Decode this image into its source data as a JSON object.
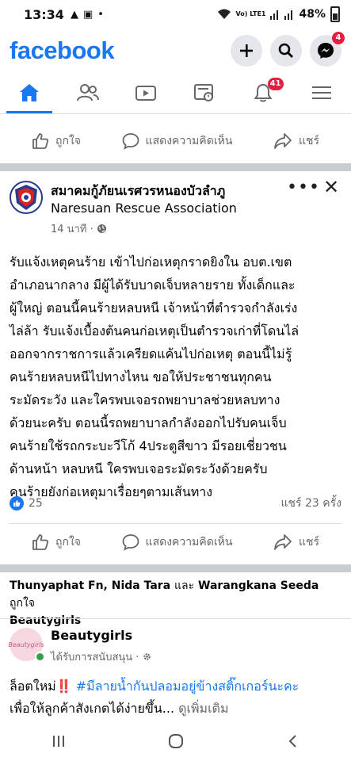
{
  "status_bar": {
    "time": "13:34",
    "network": "Vo) LTE1",
    "battery": "48%"
  },
  "header": {
    "logo": "facebook",
    "messenger_badge": "4"
  },
  "nav": {
    "video_badge": "41"
  },
  "actions": {
    "like": "ถูกใจ",
    "comment": "แสดงความคิดเห็น",
    "share": "แชร์"
  },
  "post": {
    "author_th": "สมาคมกู้ภัยนเรศวรหนองบัวลำภู",
    "author_en": "Naresuan Rescue Association",
    "time": "14 นาที ·",
    "lines": [
      "รับแจ้งเหตุคนร้าย เข้าไปก่อเหตุกราดยิงใน อบต.เขต",
      "อำเภอนากลาง มีผู้ได้รับบาดเจ็บหลายราย ทั้งเด็กและ",
      "ผู้ใหญ่ ตอนนี้คนร้ายหลบหนี เจ้าหน้าที่ตำรวจกำลังเร่ง",
      "ไล่ล้า รับแจ้งเบื้องต้นคนก่อเหตุเป็นตำรวจเก่าที่โดนไล่",
      "ออกจากราชการแล้วเครียดแค้นไปก่อเหตุ ตอนนี้ไม่รู้",
      "คนร้ายหลบหนีไปทางไหน ขอให้ประชาชนทุกคน",
      "ระมัดระวัง และใครพบเจอรถพยาบาลช่วยหลบทาง",
      "ด้วยนะครับ ตอนนี้รถพยาบาลกำลังออกไปรับคนเจ็บ",
      "คนร้ายใช้รถกระบะวีโก้ 4ประตูสีขาว มีรอยเชี่ยวชน",
      "ด้านหน้า หลบหนี ใครพบเจอระมัดระวังด้วยครับ",
      "คนร้ายยังก่อเหตุมาเรื่อยๆตามเส้นทาง"
    ],
    "reaction_count": "25",
    "share_count": "แชร์ 23 ครั้ง"
  },
  "friends_liked": {
    "names": "Thunyaphat Fn, Nida Tara",
    "and": "และ",
    "last": "Warangkana Seeda",
    "liked": "ถูกใจ",
    "page": "Beautygirls"
  },
  "ad": {
    "avatar_text": "Beautygirls",
    "name": "Beautygirls",
    "sponsored": "ได้รับการสนับสนุน ·",
    "line1_prefix": "ล็อตใหม่",
    "exclaim": "‼️",
    "hashtag": "#มีลายน้ำกันปลอมอยู่ข้างสติ๊กเกอร์นะคะ",
    "line2": "เพื่อให้ลูกค้าสังเกตได้ง่ายขึ้น...",
    "see_more": "ดูเพิ่มเติม"
  },
  "colors": {
    "brand": "#1877f2",
    "badge": "#e41e3f",
    "muted": "#65676b"
  }
}
